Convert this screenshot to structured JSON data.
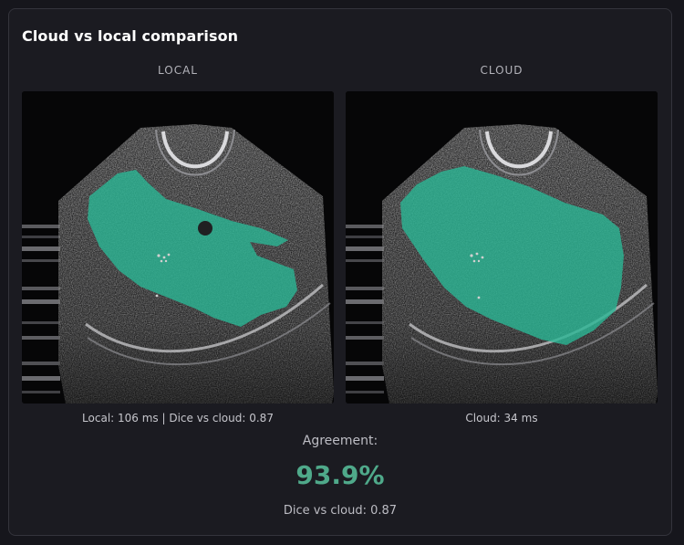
{
  "header": {
    "title": "Cloud vs local comparison"
  },
  "local": {
    "label": "LOCAL",
    "caption": "Local: 106 ms | Dice vs cloud: 0.87"
  },
  "cloud": {
    "label": "CLOUD",
    "caption": "Cloud: 34 ms"
  },
  "agreement": {
    "label": "Agreement:",
    "value": "93.9%",
    "dice_text": "Dice vs cloud: 0.87"
  },
  "colors": {
    "accent": "#4fa98a",
    "mask": "#2bb795",
    "background": "#1b1b21"
  }
}
